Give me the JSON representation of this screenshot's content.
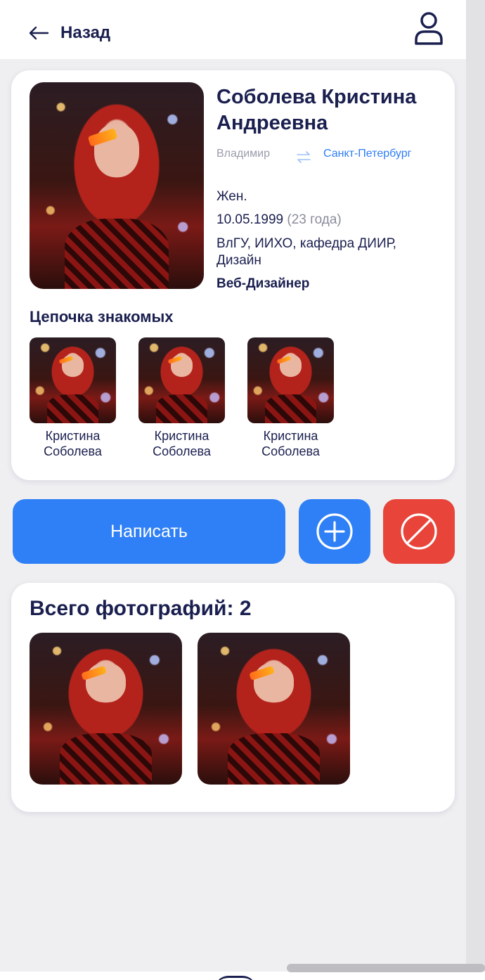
{
  "header": {
    "back_label": "Назад",
    "back_icon": "arrow-left-icon",
    "profile_icon": "user-icon"
  },
  "profile": {
    "full_name": "Соболева Кристина Андреевна",
    "city_from": "Владимир",
    "city_to": "Санкт-Петербург",
    "swap_icon": "swap-arrows-icon",
    "gender": "Жен.",
    "birth_date": "10.05.1999",
    "age": "(23 года)",
    "education": "ВлГУ, ИИХО, кафедра ДИИР, Дизайн",
    "profession": "Веб-Дизайнер"
  },
  "chain": {
    "title": "Цепочка знакомых",
    "friends": [
      {
        "first_name": "Кристина",
        "last_name": "Соболева"
      },
      {
        "first_name": "Кристина",
        "last_name": "Соболева"
      },
      {
        "first_name": "Кристина",
        "last_name": "Соболева"
      }
    ]
  },
  "actions": {
    "write_label": "Написать",
    "add_icon": "plus-circle-icon",
    "block_icon": "block-icon",
    "primary_color": "#2f80f6",
    "danger_color": "#e8443a"
  },
  "photos": {
    "title": "Всего фотографий: 2"
  }
}
